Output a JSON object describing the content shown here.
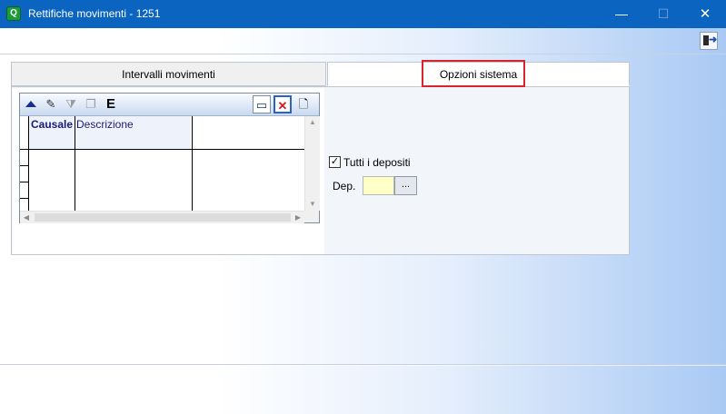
{
  "window": {
    "title": "Rettifiche movimenti - 1251",
    "app_icon": "Q",
    "minimize_glyph": "—",
    "maximize_glyph": "☐",
    "close_glyph": "✕"
  },
  "toolbar": {
    "exit_icon": "door-exit-icon"
  },
  "tabs": [
    {
      "label": "Intervalli movimenti",
      "active": false
    },
    {
      "label": "Opzioni sistema",
      "active": true
    }
  ],
  "highlight_color": "#d9232d",
  "grid": {
    "toolbar_buttons": [
      {
        "name": "move-up-icon",
        "glyph": ""
      },
      {
        "name": "edit-list-icon",
        "glyph": "✎"
      },
      {
        "name": "filter-icon",
        "glyph": "⧩"
      },
      {
        "name": "copy-icon",
        "glyph": "❐"
      },
      {
        "name": "export-icon",
        "glyph": "E"
      },
      {
        "name": "window-icon",
        "glyph": "▭"
      },
      {
        "name": "delete-icon",
        "glyph": "✕"
      },
      {
        "name": "new-page-icon",
        "glyph": "🗋"
      }
    ],
    "columns": [
      "Causale",
      "Descrizione"
    ]
  },
  "options": {
    "all_deposits_label": "Tutti i depositi",
    "all_deposits_checked": true,
    "check_glyph": "✓",
    "dep_label": "Dep.",
    "dep_value": "",
    "dep_button_label": "..."
  }
}
